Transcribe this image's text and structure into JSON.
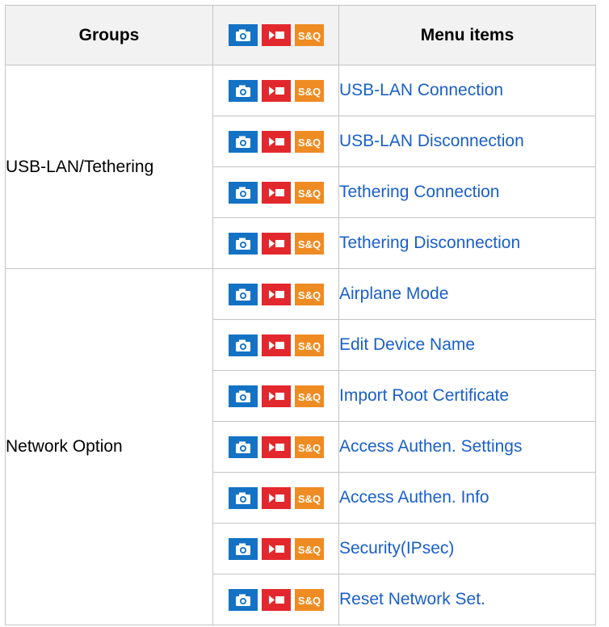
{
  "header": {
    "groups_label": "Groups",
    "menu_items_label": "Menu items",
    "sq_label": "S&Q"
  },
  "colors": {
    "photo": "#1472c4",
    "movie": "#e3282d",
    "sq": "#ee8b22",
    "link": "#1a5fc9"
  },
  "icons": [
    "camera-icon",
    "movie-icon",
    "s-and-q-icon"
  ],
  "groups": [
    {
      "name": "USB-LAN/Tethering",
      "items": [
        "USB-LAN Connection",
        "USB-LAN Disconnection",
        "Tethering Connection",
        "Tethering Disconnection"
      ]
    },
    {
      "name": "Network Option",
      "items": [
        "Airplane Mode",
        "Edit Device Name",
        "Import Root Certificate",
        "Access Authen. Settings",
        "Access Authen. Info",
        "Security(IPsec)",
        "Reset Network Set."
      ]
    }
  ]
}
